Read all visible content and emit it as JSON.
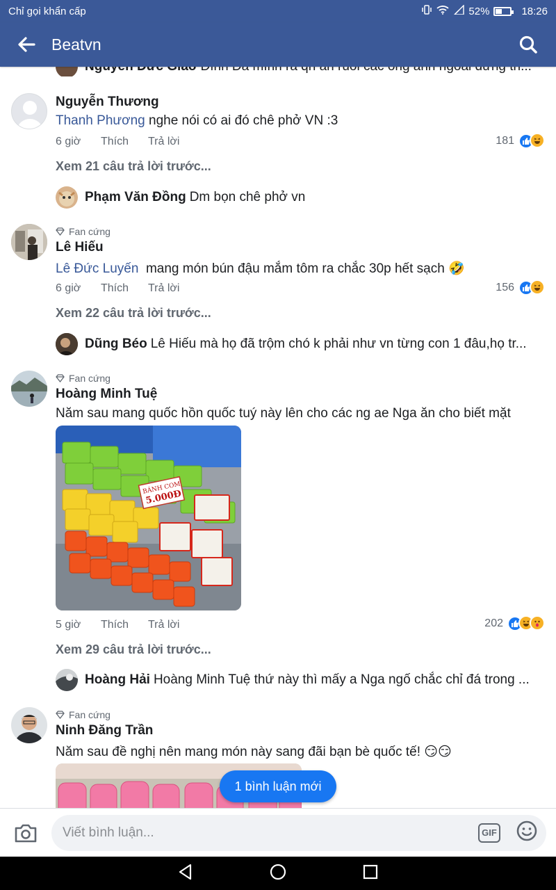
{
  "status_bar": {
    "carrier": "Chỉ gọi khẩn cấp",
    "battery": "52%",
    "time": "18:26"
  },
  "app_bar": {
    "title": "Beatvn"
  },
  "clipped_reply": {
    "name": "Nguyễn Đức Giao",
    "text": "Đình Đà mình ra qn ăn ruồi các ông anh ngoài đứng th..."
  },
  "comments": [
    {
      "name": "Nguyễn Thương",
      "mention": "Thanh Phương",
      "text": " nghe nói có ai đó chê phở VN :3",
      "time": "6 giờ",
      "like": "Thích",
      "reply": "Trả lời",
      "reaction_count": "181",
      "more_replies": "Xem 21 câu trả lời trước...",
      "last_reply": {
        "name": "Phạm Văn Đồng",
        "text": "Dm bọn chê phở vn"
      }
    },
    {
      "badge": "Fan cứng",
      "name": "Lê Hiếu",
      "mention": "Lê Đức Luyến",
      "text": "  mang món bún đậu mắm tôm ra chắc 30p hết sạch 🤣",
      "time": "6 giờ",
      "like": "Thích",
      "reply": "Trả lời",
      "reaction_count": "156",
      "more_replies": "Xem 22 câu trả lời trước...",
      "last_reply": {
        "name": "Dũng Béo",
        "text": "Lê Hiếu mà họ đã trộm chó k phải như vn từng con 1 đâu,họ tr..."
      }
    },
    {
      "badge": "Fan cứng",
      "name": "Hoàng Minh Tuệ",
      "text": "Năm sau mang quốc hồn quốc tuý này lên cho các ng ae Nga ăn cho biết mặt",
      "photo": {
        "label1": "BÁNH COM",
        "label2": "5.000Đ"
      },
      "time": "5 giờ",
      "like": "Thích",
      "reply": "Trả lời",
      "reaction_count": "202",
      "more_replies": "Xem 29 câu trả lời trước...",
      "last_reply": {
        "name": "Hoàng Hải",
        "text": "Hoàng Minh Tuệ thứ này thì mấy a Nga ngố chắc chỉ đá trong ..."
      }
    },
    {
      "badge": "Fan cứng",
      "name": "Ninh Đăng Trần",
      "text": "Năm sau đề nghị nên mang món này sang đãi bạn bè quốc tế! 😏😏"
    }
  ],
  "new_comment_pill": "1 bình luận mới",
  "composer": {
    "placeholder": "Viết bình luận...",
    "gif": "GIF"
  },
  "colors": {
    "brand": "#3b5998",
    "link": "#385898",
    "pill": "#1877f2",
    "like": "#1877f2",
    "haha": "#f7b125"
  }
}
